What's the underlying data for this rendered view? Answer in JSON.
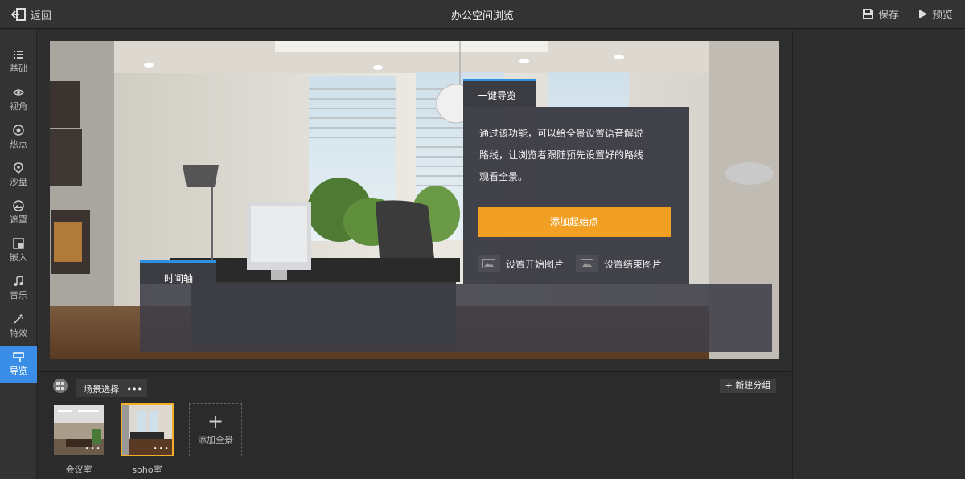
{
  "header": {
    "back_label": "返回",
    "title": "办公空间浏览",
    "save_label": "保存",
    "preview_label": "预览"
  },
  "sidebar": {
    "items": [
      {
        "label": "基础",
        "icon": "list-icon"
      },
      {
        "label": "视角",
        "icon": "eye-icon"
      },
      {
        "label": "热点",
        "icon": "target-icon"
      },
      {
        "label": "沙盘",
        "icon": "map-pin-icon"
      },
      {
        "label": "遮罩",
        "icon": "mask-icon"
      },
      {
        "label": "嵌入",
        "icon": "embed-icon"
      },
      {
        "label": "音乐",
        "icon": "music-icon"
      },
      {
        "label": "特效",
        "icon": "magic-wand-icon"
      },
      {
        "label": "导览",
        "icon": "tour-icon",
        "active": true
      }
    ]
  },
  "tour": {
    "tab_label": "一键导览",
    "description_line1": "通过该功能，可以给全景设置语音解说",
    "description_line2": "路线，让浏览者跟随预先设置好的路线",
    "description_line3": "观看全景。",
    "add_start_label": "添加起始点",
    "set_start_image_label": "设置开始图片",
    "set_end_image_label": "设置结束图片"
  },
  "timeline": {
    "tab_label": "时间轴"
  },
  "scenes": {
    "tab_label": "场景选择",
    "tab_menu": "•••",
    "new_group_label": "新建分组",
    "items": [
      {
        "label": "会议室",
        "selected": false
      },
      {
        "label": "soho室",
        "selected": true
      }
    ],
    "add_label": "添加全景",
    "add_symbol": "+"
  },
  "colors": {
    "accent_blue": "#3b8ee8",
    "accent_orange": "#f2a024",
    "selected_border": "#f2b02a"
  }
}
